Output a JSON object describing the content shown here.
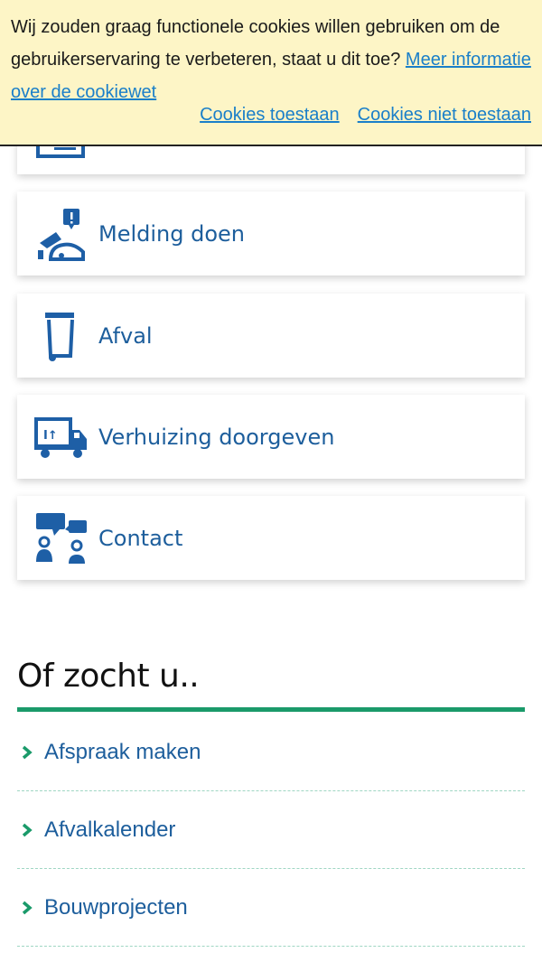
{
  "cookie_banner": {
    "text": "Wij zouden graag functionele cookies willen gebruiken om de gebruikerservaring te verbeteren, staat u dit toe?",
    "more_info_link": "Meer informatie over de cookiewet",
    "allow_label": "Cookies toestaan",
    "deny_label": "Cookies niet toestaan"
  },
  "services": {
    "items": [
      {
        "label": "",
        "icon": "id-card-icon"
      },
      {
        "label": "Melding doen",
        "icon": "report-issue-icon"
      },
      {
        "label": "Afval",
        "icon": "waste-bin-icon"
      },
      {
        "label": "Verhuizing doorgeven",
        "icon": "moving-truck-icon"
      },
      {
        "label": "Contact",
        "icon": "contact-people-icon"
      }
    ]
  },
  "also_searched": {
    "title": "Of zocht u..",
    "links": [
      {
        "label": "Afspraak maken"
      },
      {
        "label": "Afvalkalender"
      },
      {
        "label": "Bouwprojecten"
      }
    ]
  },
  "colors": {
    "brand_blue": "#1d5e9c",
    "icon_blue": "#1e5fa6",
    "accent_green": "#1a9a6a",
    "banner_bg": "#fdf5c6",
    "link_blue": "#1a7fc9"
  }
}
